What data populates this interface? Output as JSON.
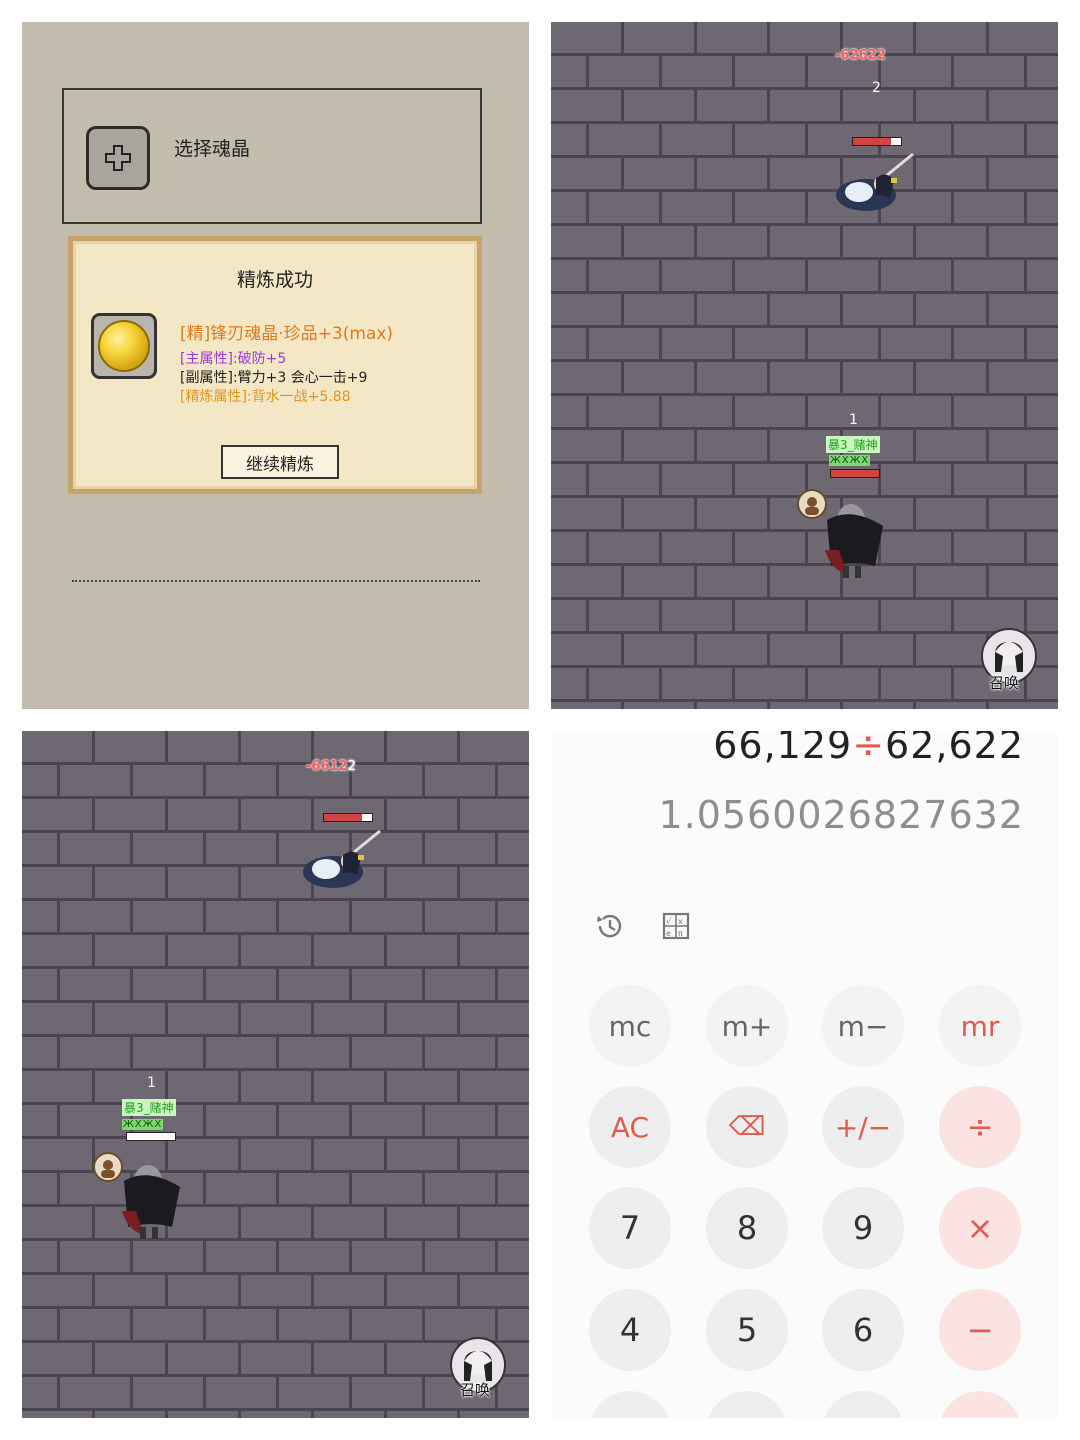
{
  "refine_panel": {
    "select_label": "选择魂晶",
    "title": "精炼成功",
    "item_name": "[精]锋刃魂晶·珍品+3(max)",
    "main_attr": "[主属性]:破防+5",
    "sub_attr": "[副属性]:臂力+3 会心一击+9",
    "refine_attr": "[精炼属性]:背水一战+5.88",
    "continue_button": "继续精炼",
    "colors": {
      "item_name": "#e07b1c",
      "main_attr": "#9a3ad6",
      "sub_attr": "#222222",
      "refine_attr": "#e0951c"
    }
  },
  "battle_top": {
    "damage_text": "-62622",
    "enemy_number": "2",
    "player_number": "1",
    "player_name": "暴3_赌神",
    "status_text": "ЖXЖX",
    "summon_label": "召唤"
  },
  "battle_bottom": {
    "damage_text": "-6612",
    "damage_suffix": "2",
    "player_number": "1",
    "player_name": "暴3_赌神",
    "status_text": "ЖXЖX",
    "summon_label": "召唤"
  },
  "calculator": {
    "expression_left": "66,129",
    "expression_op": "÷",
    "expression_right": "62,622",
    "result": "1.0560026827632",
    "tools": [
      "history-icon",
      "scientific-icon"
    ],
    "keys": {
      "mc": "mc",
      "mplus": "m+",
      "mminus": "m−",
      "mr": "mr",
      "ac": "AC",
      "backspace": "⌫",
      "sign": "+/−",
      "divide": "÷",
      "k7": "7",
      "k8": "8",
      "k9": "9",
      "multiply": "×",
      "k4": "4",
      "k5": "5",
      "k6": "6",
      "minus": "−"
    }
  }
}
